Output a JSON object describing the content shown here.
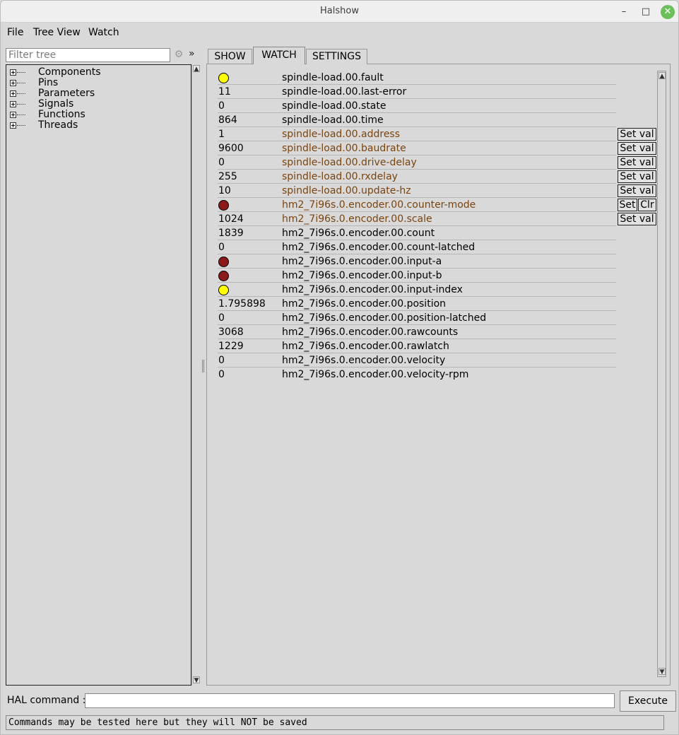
{
  "window": {
    "title": "Halshow",
    "min_glyph": "–",
    "max_glyph": "□",
    "close_glyph": "✕"
  },
  "menu": {
    "file": "File",
    "tree_view": "Tree View",
    "watch": "Watch"
  },
  "filter": {
    "placeholder": "Filter tree",
    "more_glyph": "»",
    "gear_glyph": "⚙"
  },
  "tree": {
    "items": [
      "Components",
      "Pins",
      "Parameters",
      "Signals",
      "Functions",
      "Threads"
    ]
  },
  "tabs": {
    "show": "SHOW",
    "watch": "WATCH",
    "settings": "SETTINGS",
    "active": "WATCH"
  },
  "colors": {
    "led_yellow": "#ffff00",
    "led_red": "#8b1a1a",
    "param_text": "#7a4410"
  },
  "watch_rows": [
    {
      "value": "",
      "led": "yellow",
      "name": "spindle-load.00.fault",
      "param": false,
      "buttons": []
    },
    {
      "value": "11",
      "led": "",
      "name": "spindle-load.00.last-error",
      "param": false,
      "buttons": []
    },
    {
      "value": "0",
      "led": "",
      "name": "spindle-load.00.state",
      "param": false,
      "buttons": []
    },
    {
      "value": "864",
      "led": "",
      "name": "spindle-load.00.time",
      "param": false,
      "buttons": []
    },
    {
      "value": "1",
      "led": "",
      "name": "spindle-load.00.address",
      "param": true,
      "buttons": [
        "Set val"
      ]
    },
    {
      "value": "9600",
      "led": "",
      "name": "spindle-load.00.baudrate",
      "param": true,
      "buttons": [
        "Set val"
      ]
    },
    {
      "value": "0",
      "led": "",
      "name": "spindle-load.00.drive-delay",
      "param": true,
      "buttons": [
        "Set val"
      ]
    },
    {
      "value": "255",
      "led": "",
      "name": "spindle-load.00.rxdelay",
      "param": true,
      "buttons": [
        "Set val"
      ]
    },
    {
      "value": "10",
      "led": "",
      "name": "spindle-load.00.update-hz",
      "param": true,
      "buttons": [
        "Set val"
      ]
    },
    {
      "value": "",
      "led": "red",
      "name": "hm2_7i96s.0.encoder.00.counter-mode",
      "param": true,
      "buttons": [
        "Set",
        "Clr"
      ]
    },
    {
      "value": "1024",
      "led": "",
      "name": "hm2_7i96s.0.encoder.00.scale",
      "param": true,
      "buttons": [
        "Set val"
      ]
    },
    {
      "value": "1839",
      "led": "",
      "name": "hm2_7i96s.0.encoder.00.count",
      "param": false,
      "buttons": []
    },
    {
      "value": "0",
      "led": "",
      "name": "hm2_7i96s.0.encoder.00.count-latched",
      "param": false,
      "buttons": []
    },
    {
      "value": "",
      "led": "red",
      "name": "hm2_7i96s.0.encoder.00.input-a",
      "param": false,
      "buttons": []
    },
    {
      "value": "",
      "led": "red",
      "name": "hm2_7i96s.0.encoder.00.input-b",
      "param": false,
      "buttons": []
    },
    {
      "value": "",
      "led": "yellow",
      "name": "hm2_7i96s.0.encoder.00.input-index",
      "param": false,
      "buttons": []
    },
    {
      "value": "1.795898",
      "led": "",
      "name": "hm2_7i96s.0.encoder.00.position",
      "param": false,
      "buttons": []
    },
    {
      "value": "0",
      "led": "",
      "name": "hm2_7i96s.0.encoder.00.position-latched",
      "param": false,
      "buttons": []
    },
    {
      "value": "3068",
      "led": "",
      "name": "hm2_7i96s.0.encoder.00.rawcounts",
      "param": false,
      "buttons": []
    },
    {
      "value": "1229",
      "led": "",
      "name": "hm2_7i96s.0.encoder.00.rawlatch",
      "param": false,
      "buttons": []
    },
    {
      "value": "0",
      "led": "",
      "name": "hm2_7i96s.0.encoder.00.velocity",
      "param": false,
      "buttons": []
    },
    {
      "value": "0",
      "led": "",
      "name": "hm2_7i96s.0.encoder.00.velocity-rpm",
      "param": false,
      "buttons": []
    }
  ],
  "bottom": {
    "hal_label": "HAL command :",
    "hal_value": "",
    "execute": "Execute",
    "status": "Commands may be tested here but they will NOT be saved"
  }
}
